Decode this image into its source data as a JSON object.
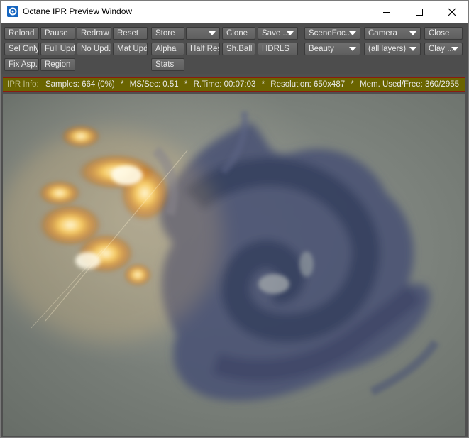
{
  "window": {
    "title": "Octane IPR Preview Window",
    "icon": "octane-app-icon",
    "controls": [
      "minimize-icon",
      "maximize-icon",
      "close-icon"
    ]
  },
  "toolbar": {
    "reload": "Reload",
    "pause": "Pause",
    "redraw": "Redraw",
    "reset": "Reset",
    "store": "Store",
    "store_slot": "",
    "clone": "Clone",
    "save": "Save ...",
    "scene_focus": "SceneFoc...",
    "camera": "Camera",
    "close": "Close",
    "sel_only": "Sel Only",
    "full_upd": "Full Upd.",
    "no_upd": "No Upd.",
    "mat_upd": "Mat Upd",
    "alpha": "Alpha",
    "half_res": "Half Res",
    "sh_ball": "Sh.Ball",
    "hdrls": "HDRLS",
    "render_pass": "Beauty",
    "layers": "(all layers)",
    "clay": "Clay ...",
    "fix_asp": "Fix Asp.",
    "region": "Region",
    "stats": "Stats"
  },
  "info": {
    "label": "IPR Info:",
    "samples": "Samples: 664 (0%)",
    "ms_sec": "MS/Sec: 0.51",
    "r_time": "R.Time: 00:07:03",
    "resolution": "Resolution: 650x487",
    "mem": "Mem. Used/Free: 360/2955",
    "sep": "*"
  },
  "render": {
    "background_color": "#7d837d",
    "smoke_color": "#3c4566",
    "fire_color": "#ffc850"
  }
}
